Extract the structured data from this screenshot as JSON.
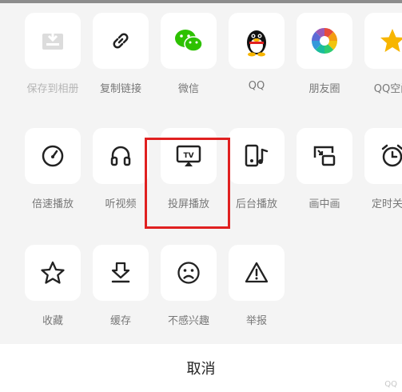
{
  "share_row": [
    {
      "label": "保存到相册",
      "icon": "save-to-album-icon",
      "disabled": true
    },
    {
      "label": "复制链接",
      "icon": "link-icon"
    },
    {
      "label": "微信",
      "icon": "wechat-icon"
    },
    {
      "label": "QQ",
      "icon": "qq-penguin-icon"
    },
    {
      "label": "朋友圈",
      "icon": "moments-icon"
    },
    {
      "label": "QQ空间",
      "icon": "qzone-star-icon"
    }
  ],
  "playback_row": [
    {
      "label": "倍速播放",
      "icon": "speedometer-icon"
    },
    {
      "label": "听视频",
      "icon": "headphones-icon"
    },
    {
      "label": "投屏播放",
      "icon": "tv-cast-icon"
    },
    {
      "label": "后台播放",
      "icon": "background-play-icon"
    },
    {
      "label": "画中画",
      "icon": "picture-in-picture-icon"
    },
    {
      "label": "定时关闭",
      "icon": "alarm-clock-icon"
    }
  ],
  "action_row": [
    {
      "label": "收藏",
      "icon": "star-icon"
    },
    {
      "label": "缓存",
      "icon": "download-icon"
    },
    {
      "label": "不感兴趣",
      "icon": "sad-face-icon"
    },
    {
      "label": "举报",
      "icon": "warning-icon"
    }
  ],
  "cancel_label": "取消",
  "tv_text": "TV",
  "watermark": "QQ",
  "colors": {
    "wechat_green": "#2dc100",
    "highlight_red": "#e02020",
    "qzone_yellow": "#f7b500"
  }
}
